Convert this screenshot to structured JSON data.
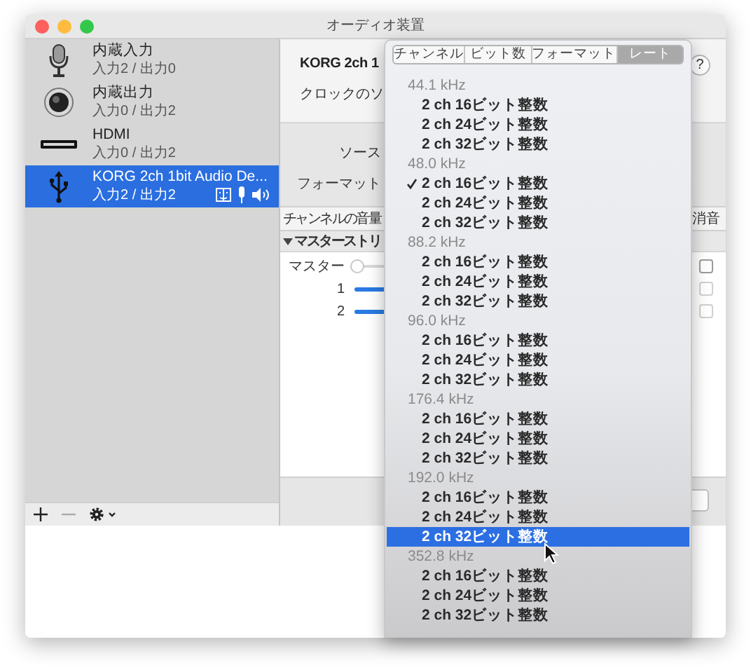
{
  "window": {
    "title": "オーディオ装置"
  },
  "sidebar": {
    "devices": [
      {
        "name": "内蔵入力",
        "io": "入力2 / 出力0",
        "selected": false
      },
      {
        "name": "内蔵出力",
        "io": "入力0 / 出力2",
        "selected": false
      },
      {
        "name": "HDMI",
        "io": "入力0 / 出力2",
        "selected": false
      },
      {
        "name": "KORG 2ch 1bit Audio De...",
        "io": "入力2 / 出力2",
        "selected": true
      }
    ]
  },
  "detail": {
    "device_title": "KORG 2ch 1",
    "clock_label": "クロックのソ",
    "help": "?",
    "source_label": "ソース",
    "format_label": "フォーマット",
    "volume_header": "チャンネルの音量",
    "mute_header": "消音",
    "stream": {
      "label": "マスターストリ",
      "expanded": true
    },
    "channels": [
      {
        "label": "マスター",
        "kind": "master",
        "muted": false,
        "level": 0
      },
      {
        "label": "1",
        "kind": "channel",
        "muted": false
      },
      {
        "label": "2",
        "kind": "channel",
        "muted": false
      }
    ]
  },
  "format_menu": {
    "tabs": [
      {
        "label": "チャンネル",
        "selected": false
      },
      {
        "label": "ビット数",
        "selected": false
      },
      {
        "label": "フォーマット",
        "selected": false
      },
      {
        "label": "レート",
        "selected": true
      }
    ],
    "groups": [
      {
        "rate": "44.1 kHz",
        "items": [
          {
            "label": "2 ch 16ビット整数",
            "checked": false,
            "highlighted": false
          },
          {
            "label": "2 ch 24ビット整数",
            "checked": false,
            "highlighted": false
          },
          {
            "label": "2 ch 32ビット整数",
            "checked": false,
            "highlighted": false
          }
        ]
      },
      {
        "rate": "48.0 kHz",
        "items": [
          {
            "label": "2 ch 16ビット整数",
            "checked": true,
            "highlighted": false
          },
          {
            "label": "2 ch 24ビット整数",
            "checked": false,
            "highlighted": false
          },
          {
            "label": "2 ch 32ビット整数",
            "checked": false,
            "highlighted": false
          }
        ]
      },
      {
        "rate": "88.2 kHz",
        "items": [
          {
            "label": "2 ch 16ビット整数",
            "checked": false,
            "highlighted": false
          },
          {
            "label": "2 ch 24ビット整数",
            "checked": false,
            "highlighted": false
          },
          {
            "label": "2 ch 32ビット整数",
            "checked": false,
            "highlighted": false
          }
        ]
      },
      {
        "rate": "96.0 kHz",
        "items": [
          {
            "label": "2 ch 16ビット整数",
            "checked": false,
            "highlighted": false
          },
          {
            "label": "2 ch 24ビット整数",
            "checked": false,
            "highlighted": false
          },
          {
            "label": "2 ch 32ビット整数",
            "checked": false,
            "highlighted": false
          }
        ]
      },
      {
        "rate": "176.4 kHz",
        "items": [
          {
            "label": "2 ch 16ビット整数",
            "checked": false,
            "highlighted": false
          },
          {
            "label": "2 ch 24ビット整数",
            "checked": false,
            "highlighted": false
          },
          {
            "label": "2 ch 32ビット整数",
            "checked": false,
            "highlighted": false
          }
        ]
      },
      {
        "rate": "192.0 kHz",
        "items": [
          {
            "label": "2 ch 16ビット整数",
            "checked": false,
            "highlighted": false
          },
          {
            "label": "2 ch 24ビット整数",
            "checked": false,
            "highlighted": false
          },
          {
            "label": "2 ch 32ビット整数",
            "checked": false,
            "highlighted": true
          }
        ]
      },
      {
        "rate": "352.8 kHz",
        "items": [
          {
            "label": "2 ch 16ビット整数",
            "checked": false,
            "highlighted": false
          },
          {
            "label": "2 ch 24ビット整数",
            "checked": false,
            "highlighted": false
          },
          {
            "label": "2 ch 32ビット整数",
            "checked": false,
            "highlighted": false
          }
        ]
      }
    ]
  }
}
